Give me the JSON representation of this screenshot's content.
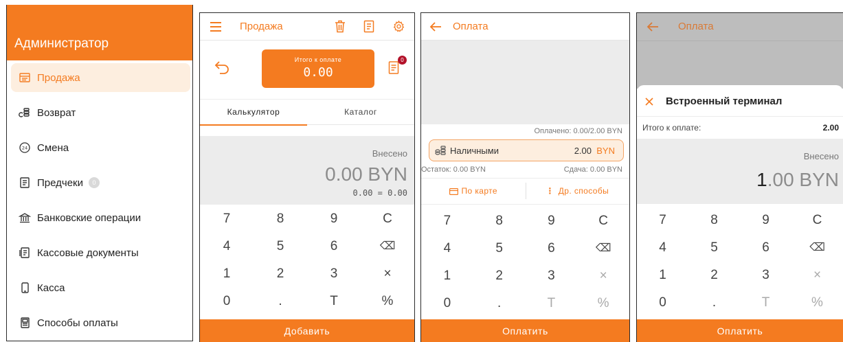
{
  "colors": {
    "accent": "#f47b20",
    "accent_light": "#fdeedf",
    "panel_gray": "#ececec"
  },
  "sidebar": {
    "title": "Администратор",
    "items": [
      {
        "label": "Продажа",
        "icon": "receipt-icon",
        "active": true
      },
      {
        "label": "Возврат",
        "icon": "coins-return-icon"
      },
      {
        "label": "Смена",
        "icon": "clock-24-icon"
      },
      {
        "label": "Предчеки",
        "icon": "document-icon",
        "badge": "0"
      },
      {
        "label": "Банковские операции",
        "icon": "bank-icon"
      },
      {
        "label": "Кассовые документы",
        "icon": "documents-icon"
      },
      {
        "label": "Касса",
        "icon": "phone-icon"
      },
      {
        "label": "Способы оплаты",
        "icon": "wallet-icon"
      }
    ]
  },
  "sale": {
    "title": "Продажа",
    "total_label": "Итого к оплате",
    "total_value": "0.00",
    "receipt_badge": "0",
    "tabs": [
      "Калькулятор",
      "Каталог"
    ],
    "entered_label": "Внесено",
    "entered_value": "0.00 BYN",
    "expression": "0.00 = 0.00",
    "keys": [
      "7",
      "8",
      "9",
      "C",
      "4",
      "5",
      "6",
      "⌫",
      "1",
      "2",
      "3",
      "×",
      "0",
      ".",
      "T",
      "%"
    ],
    "add_button": "Добавить"
  },
  "payment": {
    "title": "Оплата",
    "paid": "Оплачено: 0.00/2.00 BYN",
    "cash_label": "Наличными",
    "cash_value": "2.00",
    "cash_currency": "BYN",
    "remainder": "Остаток: 0.00 BYN",
    "change": "Сдача: 0.00 BYN",
    "card_button": "По карте",
    "other_button": "Др. способы",
    "keys": [
      "7",
      "8",
      "9",
      "C",
      "4",
      "5",
      "6",
      "⌫",
      "1",
      "2",
      "3",
      "×",
      "0",
      ".",
      "T",
      "%"
    ],
    "pay_button": "Оплатить"
  },
  "terminal": {
    "title": "Оплата",
    "sheet_title": "Встроенный терминал",
    "total_label": "Итого к оплате:",
    "total_value": "2.00",
    "entered_label": "Внесено",
    "entered_first": "1",
    "entered_rest": ".00 BYN",
    "keys": [
      "7",
      "8",
      "9",
      "C",
      "4",
      "5",
      "6",
      "⌫",
      "1",
      "2",
      "3",
      "×",
      "0",
      ".",
      "T",
      "%"
    ],
    "pay_button": "Оплатить"
  }
}
